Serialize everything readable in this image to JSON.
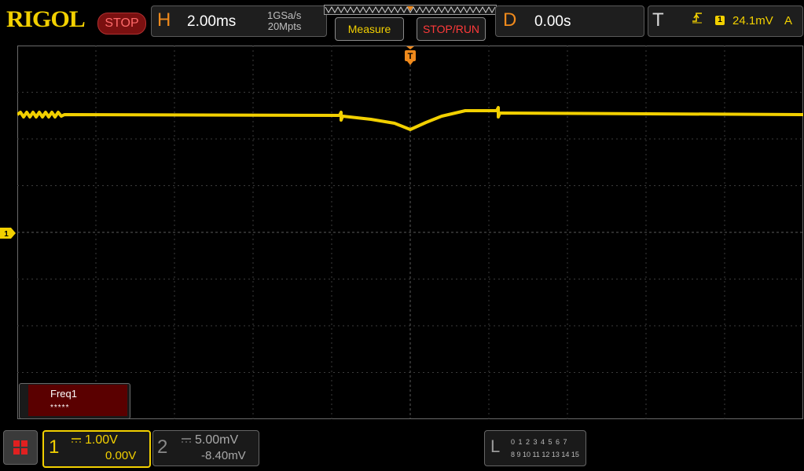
{
  "header": {
    "brand": "RIGOL",
    "status": "STOP",
    "horizontal": {
      "label": "H",
      "timebase": "2.00ms",
      "sample_rate": "1GSa/s",
      "memory_depth": "20Mpts"
    },
    "measure_label": "Measure",
    "stoprun_label": "STOP/RUN",
    "delay": {
      "label": "D",
      "value": "0.00s"
    },
    "trigger": {
      "label": "T",
      "source_channel": "1",
      "level": "24.1mV",
      "mode": "A"
    }
  },
  "display": {
    "channel1_marker": "1",
    "trigger_position_marker": "T"
  },
  "measurement": {
    "label": "Freq1",
    "value": "*****"
  },
  "channels": [
    {
      "number": "1",
      "scale": "1.00V",
      "offset": "0.00V",
      "active": true
    },
    {
      "number": "2",
      "scale": "5.00mV",
      "offset": "-8.40mV",
      "active": false
    }
  ],
  "logic_analyzer": {
    "label": "L",
    "bits_row1": "0 1 2 3  4 5 6 7",
    "bits_row2": "8 9 10 11 12 13 14 15"
  },
  "colors": {
    "channel1": "#f2d000",
    "accent_orange": "#f08a1c",
    "stop_red": "#ff3a3a"
  }
}
